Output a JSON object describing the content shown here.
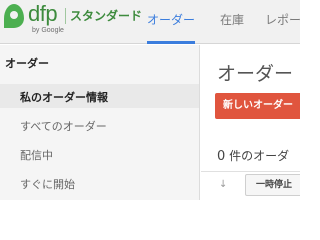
{
  "header": {
    "logo": {
      "brand": "dfp",
      "edition": "スタンダード",
      "byline": "by Google"
    },
    "tabs": [
      {
        "label": "オーダー",
        "active": true
      },
      {
        "label": "在庫",
        "active": false
      },
      {
        "label": "レポー",
        "active": false
      }
    ]
  },
  "sidebar": {
    "title": "オーダー",
    "items": [
      {
        "label": "私のオーダー情報",
        "active": true
      },
      {
        "label": "すべてのオーダー",
        "active": false
      },
      {
        "label": "配信中",
        "active": false
      },
      {
        "label": "すぐに開始",
        "active": false
      }
    ]
  },
  "main": {
    "title": "オーダー",
    "new_order_label": "新しいオーダー",
    "order_count": "0",
    "order_count_suffix": " 件のオーダ",
    "sort_icon": "sort-arrow-icon",
    "pause_label": "一時停止"
  },
  "colors": {
    "accent": "#3b7ddd",
    "brand_green": "#3d8b3d",
    "button_red": "#e0553e"
  }
}
